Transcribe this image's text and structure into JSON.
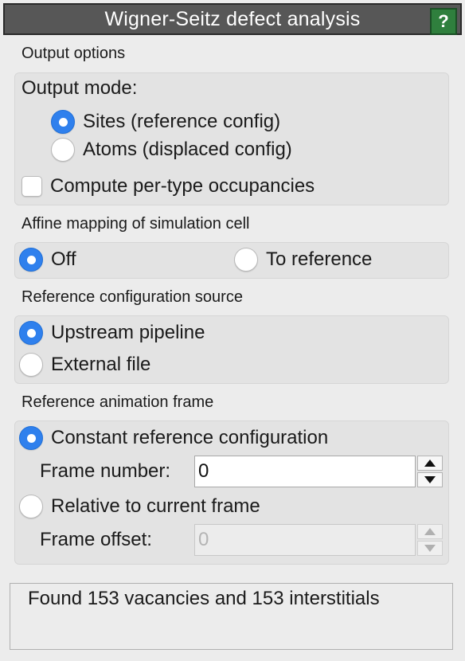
{
  "window": {
    "title": "Wigner-Seitz defect analysis",
    "help_label": "?",
    "help_color": "#2f7f3d"
  },
  "output_options": {
    "section_label": "Output options",
    "mode_label": "Output mode:",
    "modes": [
      "Sites (reference config)",
      "Atoms (displaced config)"
    ],
    "selected_mode": "Sites (reference config)",
    "per_type_label": "Compute per-type occupancies",
    "per_type_checked": false
  },
  "affine_mapping": {
    "section_label": "Affine mapping of simulation cell",
    "options": [
      "Off",
      "To reference"
    ],
    "selected": "Off"
  },
  "reference_source": {
    "section_label": "Reference configuration source",
    "options": [
      "Upstream pipeline",
      "External file"
    ],
    "selected": "Upstream pipeline"
  },
  "reference_frame": {
    "section_label": "Reference animation frame",
    "constant_label": "Constant reference configuration",
    "frame_number_label": "Frame number:",
    "frame_number_value": "0",
    "relative_label": "Relative to current frame",
    "frame_offset_label": "Frame offset:",
    "frame_offset_value": "0",
    "selected": "Constant reference configuration"
  },
  "status": {
    "message": "Found 153 vacancies and 153 interstitials"
  },
  "colors": {
    "accent": "#2f80ed",
    "titlebar": "#575757",
    "panel": "#ececec"
  }
}
